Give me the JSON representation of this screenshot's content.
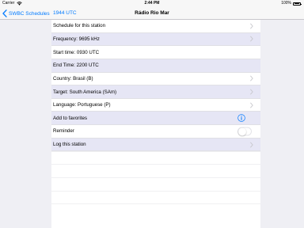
{
  "status_bar": {
    "carrier": "Carrier",
    "time": "2:44 PM",
    "battery": "100%"
  },
  "nav": {
    "back_label": "SWBC Schedules",
    "utc_time": "1944 UTC",
    "title": "Rádio Rio Mar"
  },
  "rows": [
    {
      "label": "Schedule for this station",
      "accessory": "chevron"
    },
    {
      "label": "Frequency: 9695 kHz",
      "accessory": "chevron"
    },
    {
      "label": "Start time: 0930 UTC",
      "accessory": "none"
    },
    {
      "label": "End Time: 2200 UTC",
      "accessory": "none"
    },
    {
      "label": "Country: Brasil (B)",
      "accessory": "chevron"
    },
    {
      "label": "Target: South America (SAm)",
      "accessory": "chevron"
    },
    {
      "label": "Language: Portuguese (P)",
      "accessory": "chevron"
    },
    {
      "label": "Add to favorites",
      "accessory": "info"
    },
    {
      "label": "Reminder",
      "accessory": "toggle",
      "toggle_on": false
    },
    {
      "label": "Log this station",
      "accessory": "chevron"
    }
  ],
  "colors": {
    "accent": "#007aff",
    "row_shade": "#e6e6f5",
    "background": "#efeff4"
  },
  "icons": [
    "wifi-icon",
    "battery-icon",
    "back-chevron-icon",
    "chevron-right-icon",
    "info-icon"
  ]
}
